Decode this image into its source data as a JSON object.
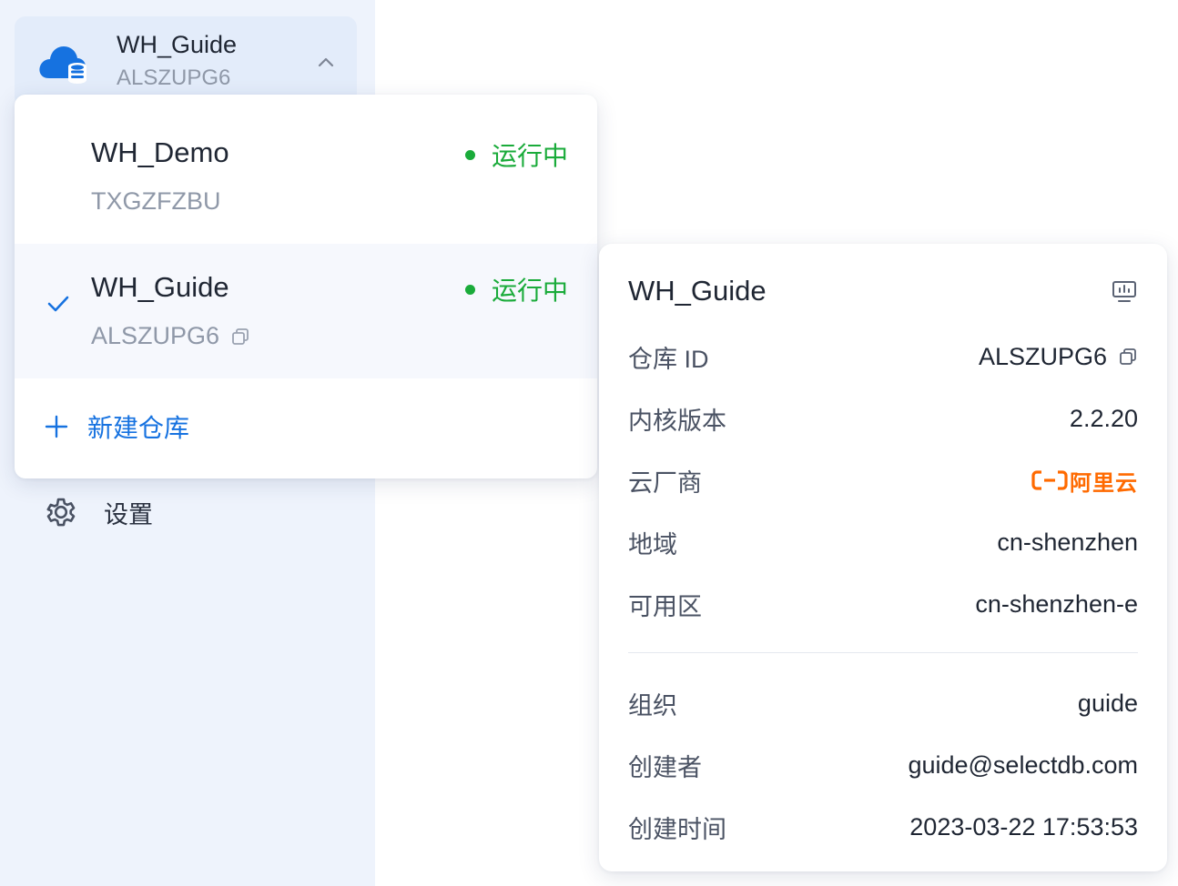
{
  "sidebar": {
    "current": {
      "name": "WH_Guide",
      "id": "ALSZUPG6"
    },
    "settings_label": "设置"
  },
  "dropdown": {
    "items": [
      {
        "name": "WH_Demo",
        "id": "TXGZFZBU",
        "status": "运行中",
        "selected": false
      },
      {
        "name": "WH_Guide",
        "id": "ALSZUPG6",
        "status": "运行中",
        "selected": true
      }
    ],
    "new_label": "新建仓库"
  },
  "detail": {
    "title": "WH_Guide",
    "rows": [
      {
        "key": "仓库 ID",
        "value": "ALSZUPG6"
      },
      {
        "key": "内核版本",
        "value": "2.2.20"
      },
      {
        "key": "云厂商",
        "value": "阿里云"
      },
      {
        "key": "地域",
        "value": "cn-shenzhen"
      },
      {
        "key": "可用区",
        "value": "cn-shenzhen-e"
      },
      {
        "key": "组织",
        "value": "guide"
      },
      {
        "key": "创建者",
        "value": "guide@selectdb.com"
      },
      {
        "key": "创建时间",
        "value": "2023-03-22 17:53:53"
      }
    ]
  },
  "colors": {
    "accent": "#1672e0",
    "running": "#1aab3a",
    "aliyun": "#ff6a00",
    "sidebar_bg": "#eef3fc"
  },
  "icons": [
    "cloud-database-icon",
    "chevron-up-icon",
    "check-icon",
    "copy-icon",
    "plus-icon",
    "gear-icon",
    "monitor-icon",
    "aliyun-logo"
  ]
}
